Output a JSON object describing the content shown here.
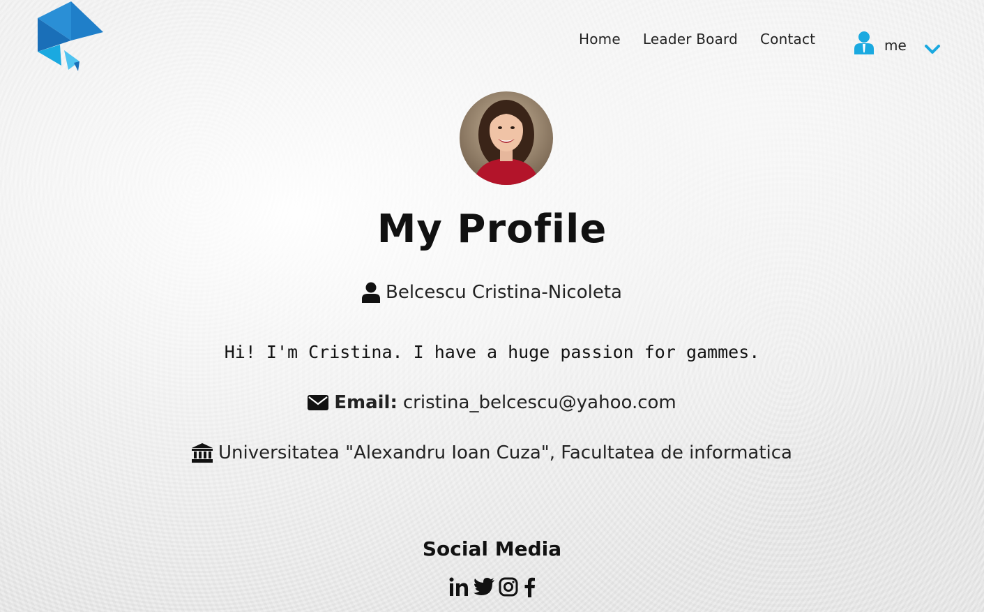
{
  "nav": {
    "links": [
      {
        "label": "Home"
      },
      {
        "label": "Leader Board"
      },
      {
        "label": "Contact"
      }
    ],
    "user_label": "me"
  },
  "profile": {
    "title": "My Profile",
    "name": "Belcescu Cristina-Nicoleta",
    "bio": "Hi! I'm Cristina. I have a huge passion for gammes.",
    "email_label": "Email:",
    "email": "cristina_belcescu@yahoo.com",
    "education": "Universitatea \"Alexandru Ioan Cuza\", Facultatea de informatica"
  },
  "social": {
    "title": "Social Media",
    "icons": [
      "linkedin-icon",
      "twitter-icon",
      "instagram-icon",
      "facebook-icon"
    ]
  },
  "colors": {
    "brand_blue": "#1f7fc9",
    "accent_cyan": "#1aa9e0",
    "text_dark": "#111111"
  }
}
